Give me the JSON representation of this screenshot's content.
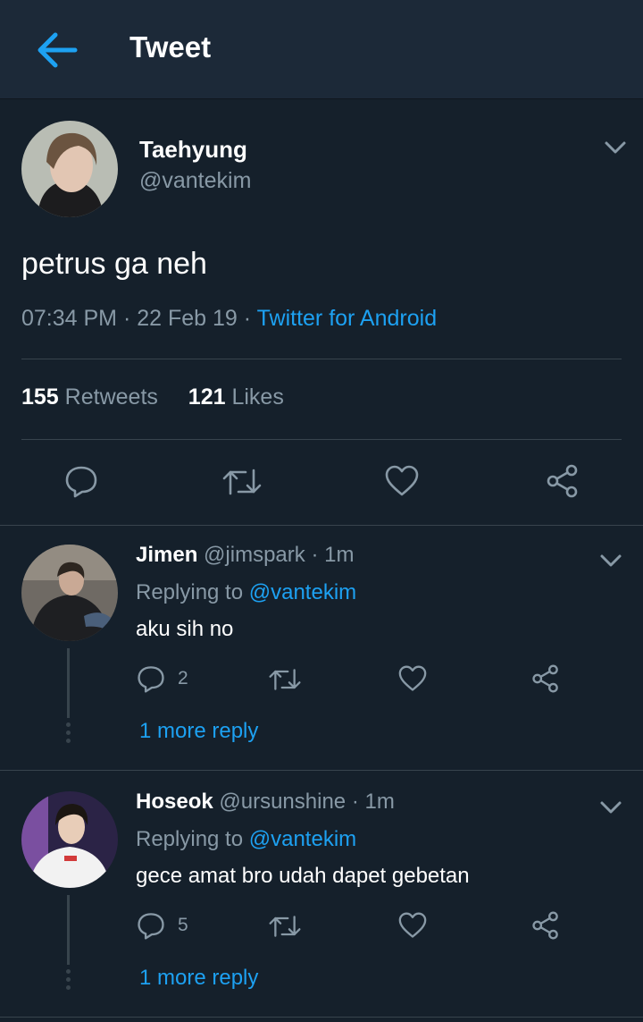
{
  "header": {
    "title": "Tweet",
    "back_icon": "arrow-left-icon"
  },
  "tweet": {
    "author_name": "Taehyung",
    "author_handle": "@vantekim",
    "text": "petrus ga neh",
    "time": "07:34 PM",
    "date": "22 Feb 19",
    "source": "Twitter for Android",
    "retweets_count": "155",
    "retweets_label": "Retweets",
    "likes_count": "121",
    "likes_label": "Likes"
  },
  "replies": [
    {
      "name": "Jimen",
      "handle": "@jimspark",
      "age": "1m",
      "replying_prefix": "Replying to",
      "replying_to": "@vantekim",
      "text": "aku sih no",
      "reply_count": "2",
      "more_replies": "1 more reply"
    },
    {
      "name": "Hoseok",
      "handle": "@ursunshine",
      "age": "1m",
      "replying_prefix": "Replying to",
      "replying_to": "@vantekim",
      "text": "gece amat bro udah dapet gebetan",
      "reply_count": "5",
      "more_replies": "1 more reply"
    }
  ],
  "colors": {
    "background": "#15202b",
    "header": "#1c2938",
    "accent": "#1da1f2",
    "muted": "#8899a6",
    "divider": "#38444d"
  }
}
